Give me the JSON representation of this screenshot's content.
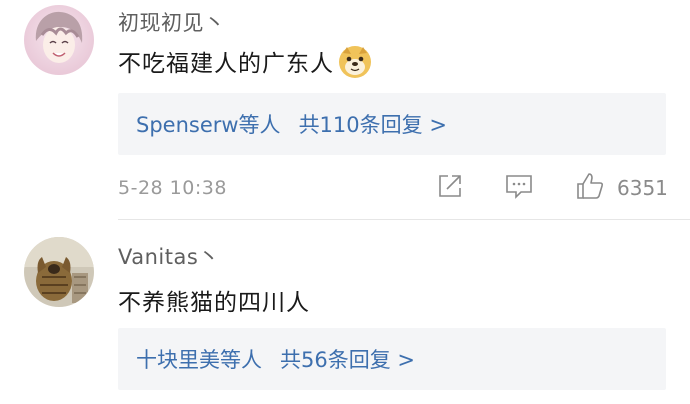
{
  "comments": [
    {
      "username": "初现初见丶",
      "text": "不吃福建人的广东人",
      "emoji": "doge-emoji",
      "replies": {
        "users": "Spenserw等人",
        "count": "共110条回复 >"
      },
      "time": "5-28 10:38",
      "likes": "6351"
    },
    {
      "username": "Vanitas丶",
      "text": "不养熊猫的四川人",
      "replies": {
        "users": "十块里美等人",
        "count": "共56条回复 >"
      }
    }
  ],
  "colors": {
    "link": "#3d6fae",
    "username": "#5f5f5f",
    "meta": "#9a9a9a",
    "reply_bg": "#f4f5f7"
  },
  "icons": [
    "share-icon",
    "comment-icon",
    "like-icon"
  ]
}
